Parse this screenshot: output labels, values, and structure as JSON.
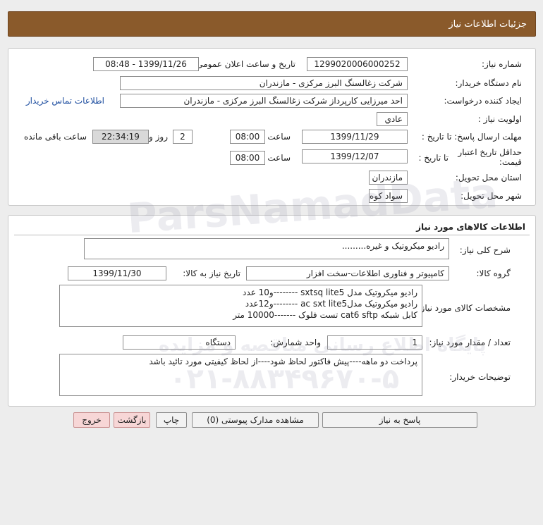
{
  "page_title": "جزئیات اطلاعات نیاز",
  "need_info": {
    "need_number_label": "شماره نیاز:",
    "need_number": "1299020006000252",
    "announce_label": "تاریخ و ساعت اعلان عمومی:",
    "announce_value": "1399/11/26 - 08:48",
    "buyer_org_label": "نام دستگاه خریدار:",
    "buyer_org": "شرکت زغالسنگ البرز مرکزی - مازندران",
    "requester_label": "ایجاد کننده درخواست:",
    "requester": "احد میرزایی کارپرداز شرکت زغالسنگ البرز مرکزی - مازندران",
    "contact_link": "اطلاعات تماس خریدار",
    "priority_label": "اولویت نیاز :",
    "priority": "عادي",
    "reply_deadline_label": "مهلت ارسال پاسخ: تا تاریخ :",
    "reply_date": "1399/11/29",
    "time_label": "ساعت",
    "reply_time": "08:00",
    "days_value": "2",
    "days_label": "روز و",
    "remaining_time": "22:34:19",
    "remaining_label": "ساعت باقی مانده",
    "price_validity_label_1": "حداقل تاریخ اعتبار",
    "price_validity_label_2": "قیمت:",
    "until_date_label": "تا تاریخ :",
    "validity_date": "1399/12/07",
    "validity_time": "08:00",
    "province_label": "استان محل تحویل:",
    "province": "مازندران",
    "city_label": "شهر محل تحویل:",
    "city": "سواد کوه"
  },
  "goods": {
    "section_title": "اطلاعات کالاهای مورد نیاز",
    "summary_label": "شرح کلی نیاز:",
    "summary": "رادیو میکروتیک و غیره.........",
    "group_label": "گروه کالا:",
    "group": "کامپیوتر و فناوری اطلاعات-سخت افزار",
    "need_date_label": "تاریخ نیاز به کالا:",
    "need_date": "1399/11/30",
    "specs_label": "مشخصات کالای مورد نیاز:",
    "spec_lines": [
      "رادیو میکروتیک مدل sxtsq lite5 --------و10 عدد",
      "رادیو میکروتیک مدلac sxt lite5 --------و12عدد",
      "کابل شبکه cat6 sftp تست فلوک -------10000 متر"
    ],
    "qty_label": "تعداد / مقدار مورد نیاز:",
    "qty": "1",
    "unit_label": "واحد شمارش:",
    "unit": "دستگاه",
    "buyer_notes_label": "توضیحات خریدار:",
    "buyer_notes": "پرداخت دو ماهه----پیش فاکتور لحاظ شود----از لحاظ کیفیتی مورد تائید باشد"
  },
  "buttons": {
    "reply": "پاسخ به نیاز",
    "attachments": "مشاهده مدارک پیوستی (0)",
    "print": "چاپ",
    "back": "بازگشت",
    "exit": "خروج"
  },
  "watermark": {
    "brand": "ParsNamadData",
    "slogan": "پایگاه اطلاع رسانی مناقصه و مزایده",
    "phone": "۰۲۱-۸۸۳۴۹۶۷۰-۵"
  }
}
